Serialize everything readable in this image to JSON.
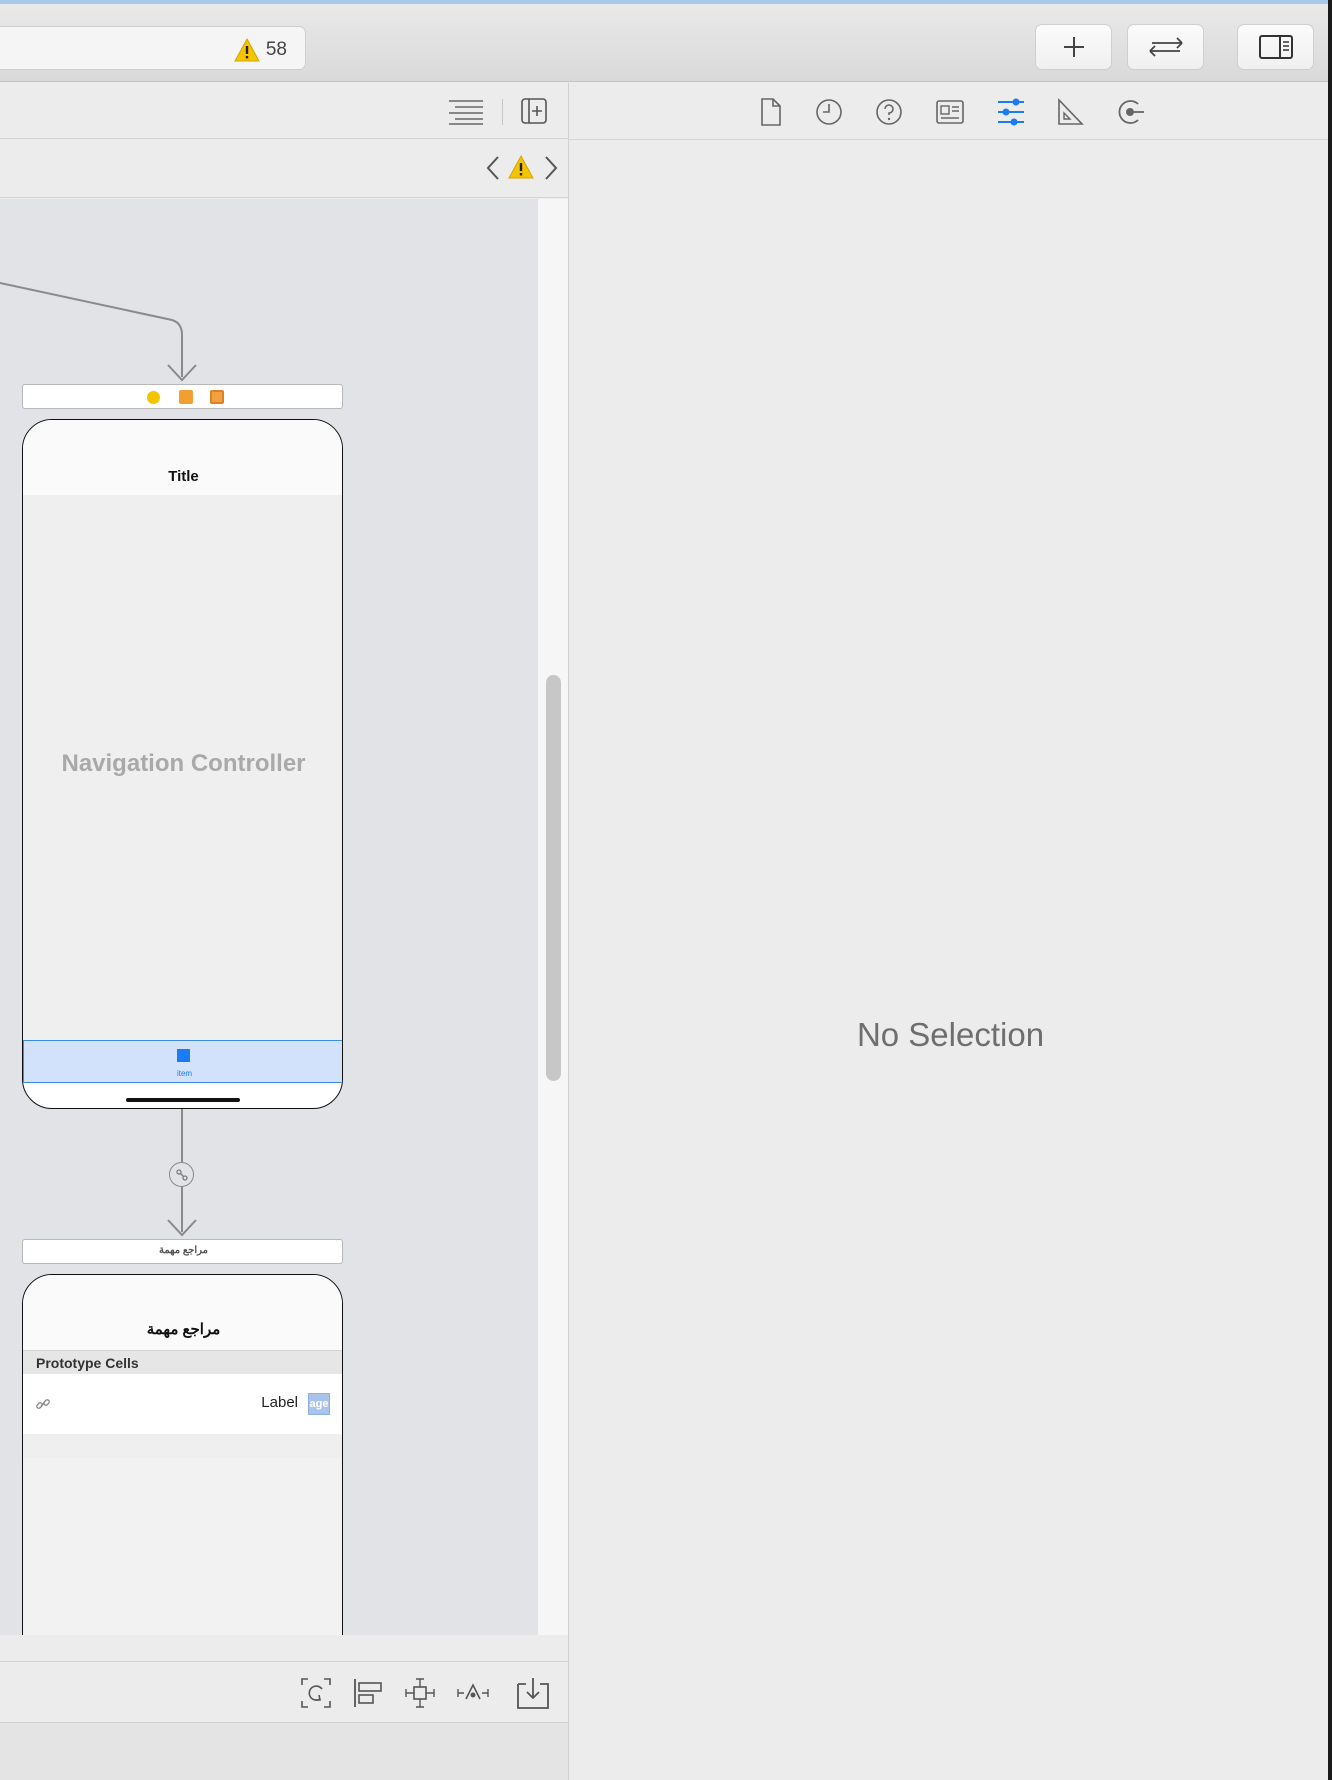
{
  "toolbar": {
    "warning_count": "58",
    "buttons": [
      "add-library",
      "code-review",
      "inspectors-toggle"
    ]
  },
  "canvas": {
    "nav_controller": {
      "title": "Title",
      "placeholder": "Navigation Controller",
      "tab_item_label": "item"
    },
    "table_scene": {
      "scene_bar_label": "مراجع مهمة",
      "title": "مراجع مهمة",
      "section_header": "Prototype Cells",
      "cell_label": "Label",
      "image_placeholder": "age"
    }
  },
  "inspector": {
    "tabs": [
      "file",
      "history",
      "quick-help",
      "identity",
      "attributes",
      "size",
      "connections"
    ],
    "active_tab": "attributes",
    "empty_message": "No Selection"
  },
  "colors": {
    "accent": "#1a7cf5",
    "warning": "#f5c400",
    "tab_selection": "#d3e2fb"
  }
}
